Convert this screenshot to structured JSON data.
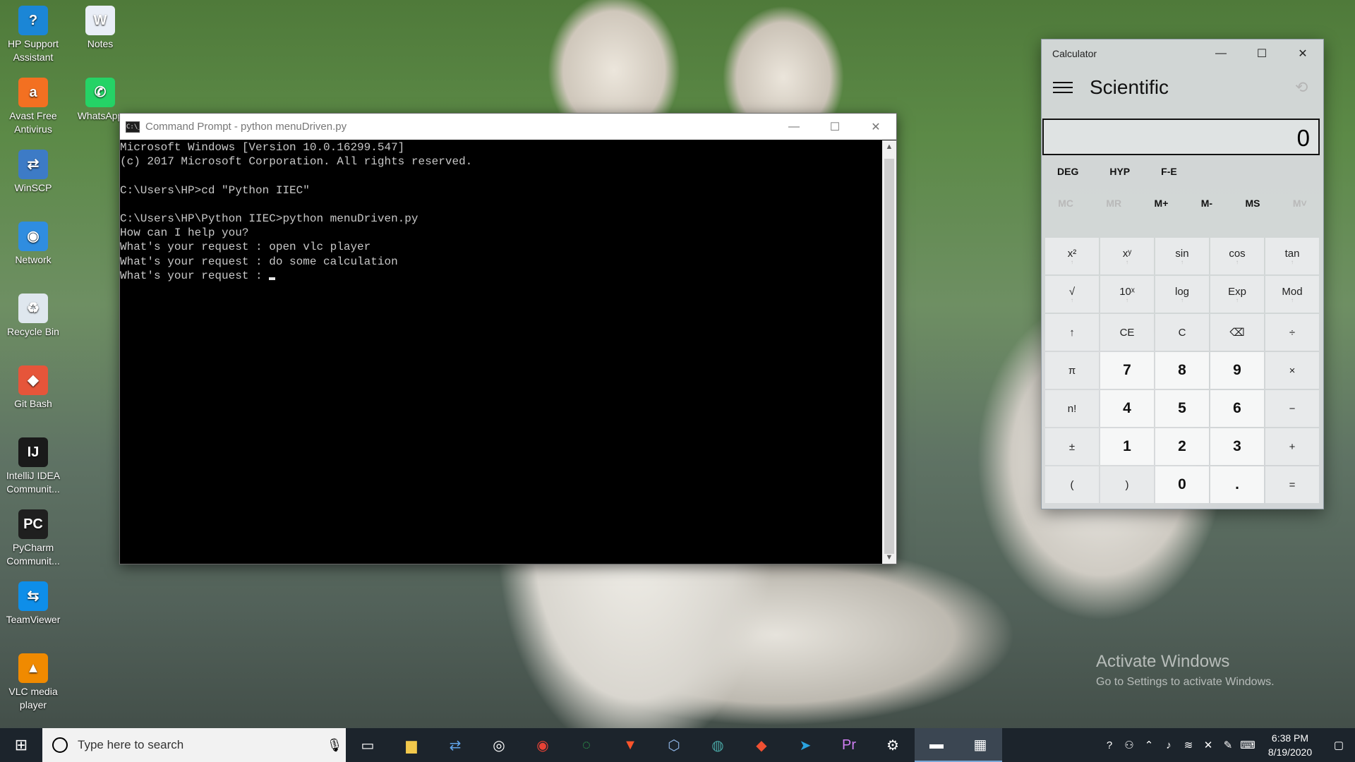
{
  "desktop": {
    "icons": [
      {
        "label": "HP Support Assistant",
        "glyph": "?",
        "color": "#1b86d6"
      },
      {
        "label": "Notes",
        "glyph": "W",
        "color": "#e9eef7"
      },
      {
        "label": "Avast Free Antivirus",
        "glyph": "a",
        "color": "#f37021"
      },
      {
        "label": "WhatsApp",
        "glyph": "✆",
        "color": "#25d366"
      },
      {
        "label": "WinSCP",
        "glyph": "⇄",
        "color": "#3d7bc6"
      },
      {
        "label": "Network",
        "glyph": "◉",
        "color": "#2f8de0"
      },
      {
        "label": "Recycle Bin",
        "glyph": "♻",
        "color": "#dfe7ee"
      },
      {
        "label": "Git Bash",
        "glyph": "◆",
        "color": "#e6553a"
      },
      {
        "label": "IntelliJ IDEA Communit...",
        "glyph": "IJ",
        "color": "#1a1a1a"
      },
      {
        "label": "PyCharm Communit...",
        "glyph": "PC",
        "color": "#1f1f1f"
      },
      {
        "label": "TeamViewer",
        "glyph": "⇆",
        "color": "#0e8ee9"
      },
      {
        "label": "VLC media player",
        "glyph": "▲",
        "color": "#f08a00"
      }
    ]
  },
  "cmd": {
    "title": "Command Prompt - python  menuDriven.py",
    "icon": "C:\\_",
    "lines": [
      "Microsoft Windows [Version 10.0.16299.547]",
      "(c) 2017 Microsoft Corporation. All rights reserved.",
      "",
      "C:\\Users\\HP>cd \"Python IIEC\"",
      "",
      "C:\\Users\\HP\\Python IIEC>python menuDriven.py",
      "How can I help you?",
      "What's your request : open vlc player",
      "What's your request : do some calculation",
      "What's your request : "
    ]
  },
  "window_buttons": {
    "minimize": "—",
    "maximize": "☐",
    "close": "✕"
  },
  "calculator": {
    "title": "Calculator",
    "mode": "Scientific",
    "display": "0",
    "angle": [
      "DEG",
      "HYP",
      "F-E"
    ],
    "memory": [
      "MC",
      "MR",
      "M+",
      "M-",
      "MS",
      "M˅"
    ],
    "keys": [
      {
        "label": "x²",
        "sub": "↑",
        "type": "fn"
      },
      {
        "label": "xʸ",
        "sub": "↑",
        "type": "fn"
      },
      {
        "label": "sin",
        "sub": "↑",
        "type": "fn"
      },
      {
        "label": "cos",
        "sub": "↑",
        "type": "fn"
      },
      {
        "label": "tan",
        "sub": "↑",
        "type": "fn"
      },
      {
        "label": "√",
        "sub": "↑",
        "type": "fn"
      },
      {
        "label": "10ˣ",
        "sub": "↑",
        "type": "fn"
      },
      {
        "label": "log",
        "sub": "↑",
        "type": "fn"
      },
      {
        "label": "Exp",
        "sub": "↑",
        "type": "fn"
      },
      {
        "label": "Mod",
        "sub": "↑",
        "type": "fn"
      },
      {
        "label": "↑",
        "sub": "",
        "type": "fn"
      },
      {
        "label": "CE",
        "sub": "",
        "type": "fn"
      },
      {
        "label": "C",
        "sub": "",
        "type": "fn"
      },
      {
        "label": "⌫",
        "sub": "",
        "type": "fn"
      },
      {
        "label": "÷",
        "sub": "",
        "type": "fn"
      },
      {
        "label": "π",
        "sub": "",
        "type": "fn"
      },
      {
        "label": "7",
        "sub": "",
        "type": "num"
      },
      {
        "label": "8",
        "sub": "",
        "type": "num"
      },
      {
        "label": "9",
        "sub": "",
        "type": "num"
      },
      {
        "label": "×",
        "sub": "",
        "type": "fn"
      },
      {
        "label": "n!",
        "sub": "",
        "type": "fn"
      },
      {
        "label": "4",
        "sub": "",
        "type": "num"
      },
      {
        "label": "5",
        "sub": "",
        "type": "num"
      },
      {
        "label": "6",
        "sub": "",
        "type": "num"
      },
      {
        "label": "−",
        "sub": "",
        "type": "fn"
      },
      {
        "label": "±",
        "sub": "",
        "type": "fn"
      },
      {
        "label": "1",
        "sub": "",
        "type": "num"
      },
      {
        "label": "2",
        "sub": "",
        "type": "num"
      },
      {
        "label": "3",
        "sub": "",
        "type": "num"
      },
      {
        "label": "+",
        "sub": "",
        "type": "fn"
      },
      {
        "label": "(",
        "sub": "",
        "type": "fn"
      },
      {
        "label": ")",
        "sub": "",
        "type": "fn"
      },
      {
        "label": "0",
        "sub": "",
        "type": "num"
      },
      {
        "label": ".",
        "sub": "",
        "type": "num"
      },
      {
        "label": "=",
        "sub": "",
        "type": "fn"
      }
    ]
  },
  "activation": {
    "line1": "Activate Windows",
    "line2": "Go to Settings to activate Windows."
  },
  "taskbar": {
    "search_placeholder": "Type here to search",
    "apps": [
      {
        "name": "task-view",
        "glyph": "▭",
        "color": "#ffffff"
      },
      {
        "name": "file-explorer",
        "glyph": "▆",
        "color": "#f2c94c"
      },
      {
        "name": "winscp",
        "glyph": "⇄",
        "color": "#5fa3e8"
      },
      {
        "name": "groove",
        "glyph": "◎",
        "color": "#ffffff"
      },
      {
        "name": "chrome",
        "glyph": "◉",
        "color": "#e94235"
      },
      {
        "name": "loader",
        "glyph": "◌",
        "color": "#34c759"
      },
      {
        "name": "brave",
        "glyph": "▼",
        "color": "#fb542b"
      },
      {
        "name": "virtualbox",
        "glyph": "⬡",
        "color": "#8fb5e6"
      },
      {
        "name": "gitkraken",
        "glyph": "◍",
        "color": "#49a5a3"
      },
      {
        "name": "git",
        "glyph": "◆",
        "color": "#f05032"
      },
      {
        "name": "telegram",
        "glyph": "➤",
        "color": "#2aa3e0"
      },
      {
        "name": "premiere-pro",
        "glyph": "Pr",
        "color": "#d17ff4"
      },
      {
        "name": "settings",
        "glyph": "⚙",
        "color": "#ffffff"
      },
      {
        "name": "command-prompt",
        "glyph": "▬",
        "color": "#ffffff"
      },
      {
        "name": "calculator",
        "glyph": "▦",
        "color": "#ffffff"
      }
    ],
    "time": "6:38 PM",
    "date": "8/19/2020"
  }
}
